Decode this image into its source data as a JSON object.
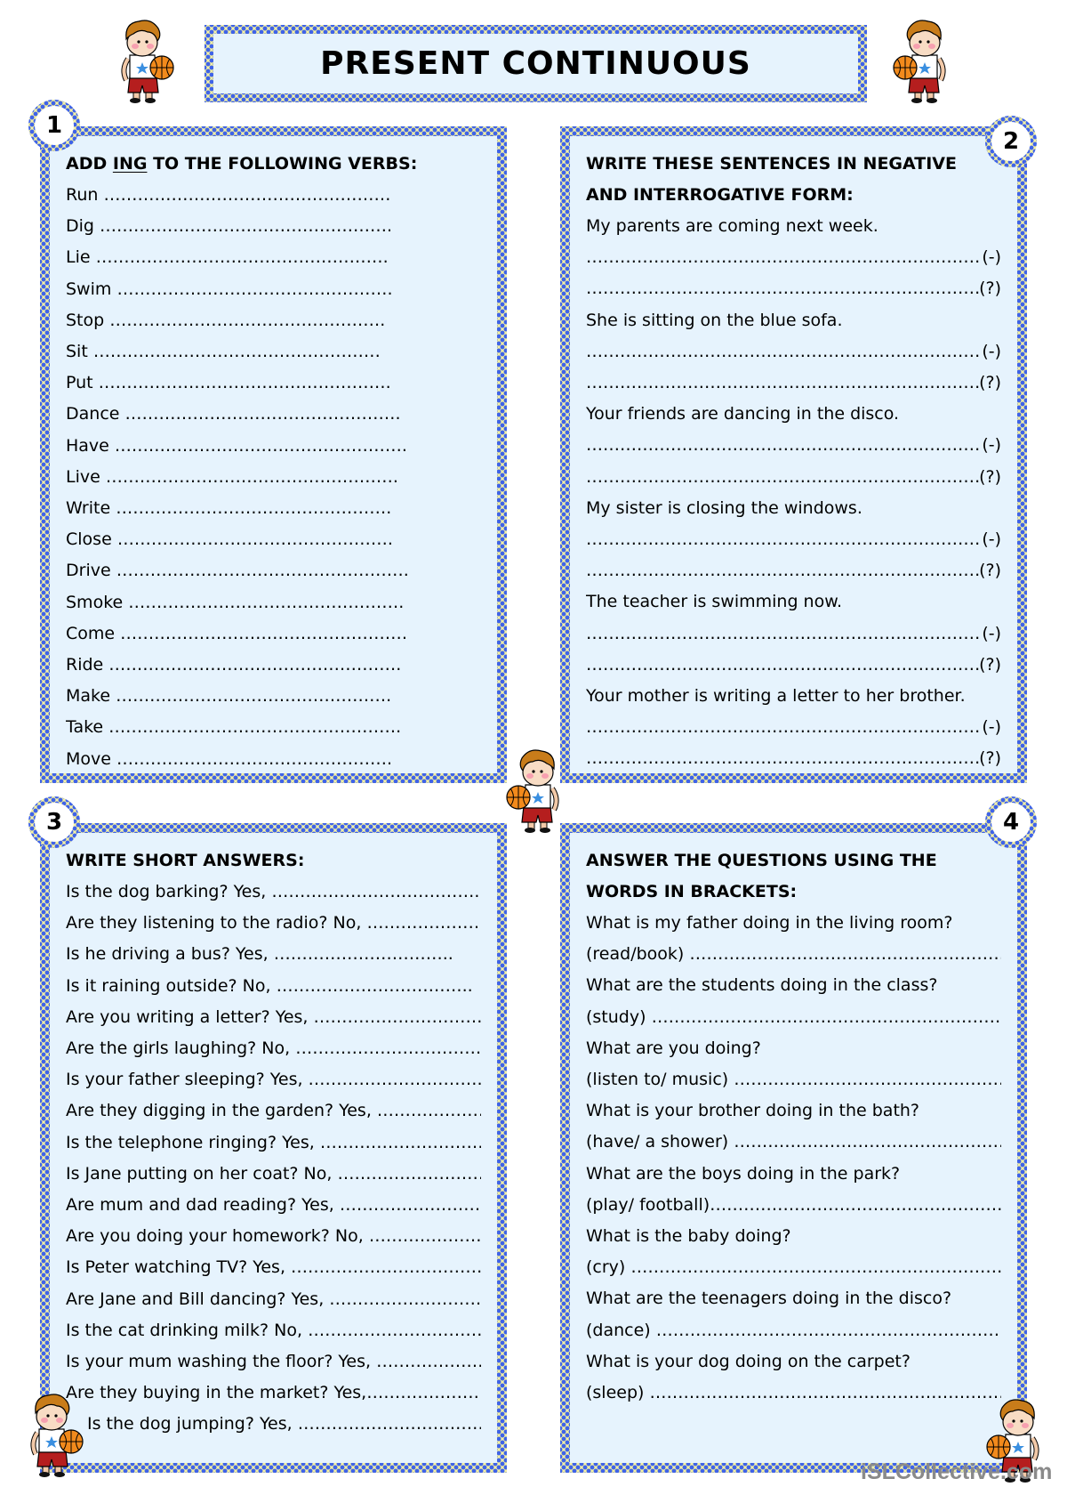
{
  "title": "PRESENT CONTINUOUS",
  "watermark": "iSLCollective.com",
  "colors": {
    "border_blue": "#3f63e8",
    "border_yellow": "#f7f3a0",
    "panel_bg": "#e6f3fd"
  },
  "exercise1": {
    "number": "1",
    "heading_pre": "ADD ",
    "heading_underlined": "ING",
    "heading_post": " TO THE FOLLOWING VERBS:",
    "items": [
      {
        "verb": "Run",
        "blank": "……………………………………………"
      },
      {
        "verb": "Dig",
        "blank": "……………………………………………."
      },
      {
        "verb": "Lie",
        "blank": "……………………………………………."
      },
      {
        "verb": "Swim",
        "blank": "…………………………………………."
      },
      {
        "verb": "Stop",
        "blank": "…………………………………………."
      },
      {
        "verb": "Sit",
        "blank": "……………………………………………"
      },
      {
        "verb": "Put",
        "blank": "……………………………………………."
      },
      {
        "verb": "Dance",
        "blank": "…………………………………………."
      },
      {
        "verb": "Have",
        "blank": "……………………………………………."
      },
      {
        "verb": "Live",
        "blank": "……………………………………………."
      },
      {
        "verb": "Write",
        "blank": "…………………………………………."
      },
      {
        "verb": "Close",
        "blank": "…………………………………………."
      },
      {
        "verb": "Drive",
        "blank": "……………………………………………."
      },
      {
        "verb": "Smoke",
        "blank": "…………………………………………."
      },
      {
        "verb": "Come",
        "blank": "……………………………………………"
      },
      {
        "verb": "Ride",
        "blank": "……………………………………………."
      },
      {
        "verb": "Make",
        "blank": "…………………………………………."
      },
      {
        "verb": "Take",
        "blank": "……………………………………………."
      },
      {
        "verb": "Move",
        "blank": "…………………………………………."
      }
    ]
  },
  "exercise2": {
    "number": "2",
    "heading_line1": "WRITE THESE SENTENCES IN NEGATIVE",
    "heading_line2": "AND INTERROGATIVE FORM:",
    "negative_marker": "(-)",
    "question_marker": "(?)",
    "blank": "……………………………………………………………………………………",
    "sentences": [
      "My parents are coming next week.",
      "She is sitting on the blue sofa.",
      "Your friends are dancing in the disco.",
      "My sister is closing the windows.",
      "The teacher is swimming now.",
      "Your mother is writing a letter to her brother."
    ]
  },
  "exercise3": {
    "number": "3",
    "heading": "WRITE SHORT ANSWERS:",
    "items": [
      {
        "question": "Is the dog barking? Yes, ",
        "blank": "……………………………….…"
      },
      {
        "question": "Are they listening to the radio? No, ",
        "blank": "……………………."
      },
      {
        "question": "Is he driving a bus? Yes, ",
        "blank": "………………………….."
      },
      {
        "question": "Is it raining outside? No, ",
        "blank": "…………………………….."
      },
      {
        "question": "Are you writing a letter? Yes, ",
        "blank": "…………………………"
      },
      {
        "question": "Are the girls laughing? No, ",
        "blank": "………………………………"
      },
      {
        "question": "Is your father sleeping? Yes, ",
        "blank": "………………………….."
      },
      {
        "question": "Are they digging in the garden? Yes, ",
        "blank": "……………………."
      },
      {
        "question": "Is the telephone ringing? Yes, ",
        "blank": "……………………………"
      },
      {
        "question": "Is Jane putting on her coat? No, ",
        "blank": "………………………."
      },
      {
        "question": "Are mum and dad reading? Yes, ",
        "blank": "……………………………"
      },
      {
        "question": "Are you doing your homework? No, ",
        "blank": "………………………."
      },
      {
        "question": "Is Peter watching TV? Yes, ",
        "blank": "…………………………………."
      },
      {
        "question": "Are Jane and Bill dancing? Yes, ",
        "blank": "……………………………."
      },
      {
        "question": "Is the cat drinking milk? No, ",
        "blank": "…………………………………"
      },
      {
        "question": "Is your mum washing the floor? Yes, ",
        "blank": "…………………….."
      },
      {
        "question": "Are they buying in the market? Yes,",
        "blank": "……………………."
      },
      {
        "question": "Is the dog jumping? Yes, ",
        "blank": "……………………………….",
        "indented": true
      }
    ]
  },
  "exercise4": {
    "number": "4",
    "heading_line1": "ANSWER THE QUESTIONS USING THE",
    "heading_line2": "WORDS IN BRACKETS:",
    "items": [
      {
        "question": "What is my father doing in the living room?",
        "hint": "(read/book) ",
        "blank": "………………………………………………………………."
      },
      {
        "question": "What are the students doing in the class?",
        "hint": "(study) ",
        "blank": "…………………………………………………………………."
      },
      {
        "question": "What are you doing?",
        "hint": "(listen to/ music) ",
        "blank": "……………………………………………………….."
      },
      {
        "question": "What is your brother doing in the bath?",
        "hint": "(have/ a shower) ",
        "blank": "………………………………………………………"
      },
      {
        "question": "What are the boys doing in the park?",
        "hint": "(play/ football)",
        "blank": "…………………………………………………….."
      },
      {
        "question": "What is the baby doing?",
        "hint": "(cry) ",
        "blank": "……………………………………………………………………."
      },
      {
        "question": "What are the teenagers doing in the disco?",
        "hint": "(dance) ",
        "blank": "………………………………………………………………….."
      },
      {
        "question": "What is your dog doing on the carpet?",
        "hint": "(sleep) ",
        "blank": "……………………………………………………………."
      }
    ]
  },
  "illustrations": {
    "boy": "boy-with-basketball"
  }
}
